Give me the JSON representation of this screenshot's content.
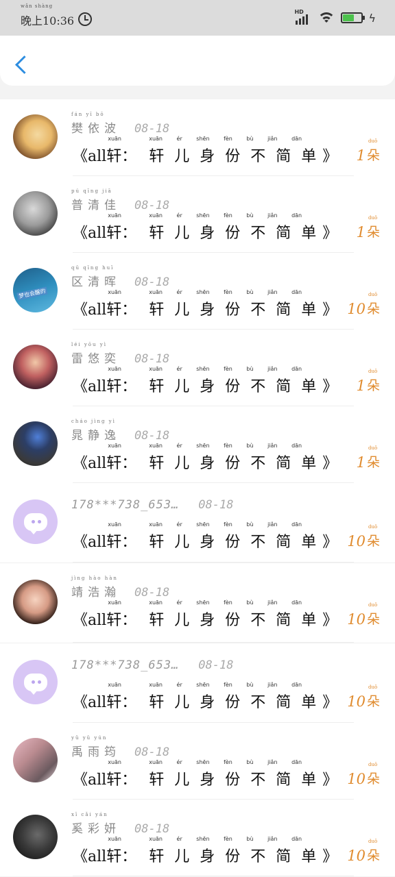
{
  "status_bar": {
    "time_pinyin": "wǎn shàng",
    "time": "晚上10:36",
    "hd": "HD",
    "icons": [
      "alarm-icon",
      "signal-icon",
      "wifi-icon",
      "battery-icon",
      "charging-icon"
    ],
    "battery_level": 0.6,
    "colors": {
      "bar": "#dcdcdc",
      "battery": "#4cc24c"
    }
  },
  "header": {
    "back_icon": "chevron-left-icon",
    "accent": "#2d8de0"
  },
  "gift_text": {
    "prefix": "《all",
    "xuan_pinyin": "xuān",
    "xuan": "轩：",
    "chars_pinyin": "xuān ér shēn fèn bù jiǎn dān",
    "chars": "轩儿身份不简单",
    "suffix": "》"
  },
  "unit_pinyin": "duǒ",
  "unit": "朵",
  "count_color": "#e08b2e",
  "records": [
    {
      "avatar": "avatar-photo-sunglasses",
      "name_pinyin": "fán yī bō",
      "name": "樊依波",
      "date": "08-18",
      "count": "1"
    },
    {
      "avatar": "avatar-photo-phone",
      "name_pinyin": "pú qīng jiā",
      "name": "普清佳",
      "date": "08-18",
      "count": "1"
    },
    {
      "avatar": "avatar-photo-sea",
      "avatar_caption": "梦也会醒的",
      "name_pinyin": "qū qīng huī",
      "name": "区清晖",
      "date": "08-18",
      "count": "10"
    },
    {
      "avatar": "avatar-photo-girl",
      "name_pinyin": "léi yōu yì",
      "name": "雷悠奕",
      "date": "08-18",
      "count": "1"
    },
    {
      "avatar": "avatar-photo-cap",
      "name_pinyin": "cháo jìng yì",
      "name": "晁静逸",
      "date": "08-18",
      "count": "1"
    },
    {
      "avatar": "avatar-default",
      "name": "178***738_653…",
      "date": "08-18",
      "count": "10"
    },
    {
      "avatar": "avatar-photo-woman",
      "name_pinyin": "jìng hào hàn",
      "name": "靖浩瀚",
      "date": "08-18",
      "count": "10"
    },
    {
      "avatar": "avatar-default",
      "name": "178***738_653…",
      "date": "08-18",
      "count": "10"
    },
    {
      "avatar": "avatar-photo-couple",
      "name_pinyin": "yǔ yǔ yún",
      "name": "禹雨筠",
      "date": "08-18",
      "count": "10"
    },
    {
      "avatar": "avatar-photo-dark",
      "name_pinyin": "xī cǎi yán",
      "name": "奚彩妍",
      "date": "08-18",
      "count": "10"
    }
  ]
}
